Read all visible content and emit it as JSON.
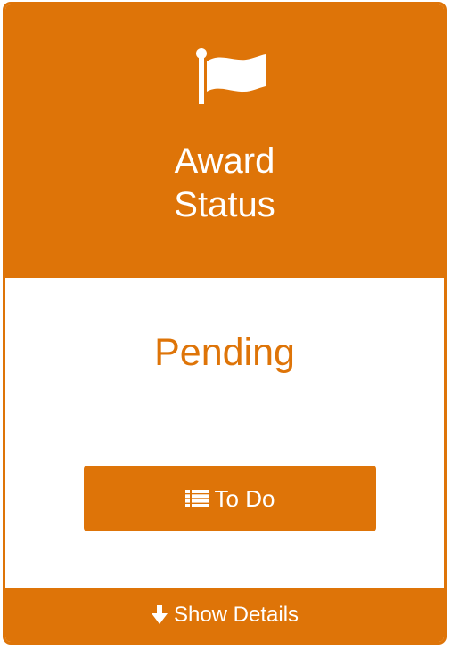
{
  "card": {
    "icon": "flag-icon",
    "title_line1": "Award",
    "title_line2": "Status",
    "status": "Pending",
    "action_button": {
      "icon": "list-icon",
      "label": "To Do"
    },
    "footer": {
      "icon": "arrow-down-icon",
      "label": "Show Details"
    }
  },
  "colors": {
    "accent": "#DE7408",
    "text_on_accent": "#FFFFFF",
    "background": "#FFFFFF"
  }
}
